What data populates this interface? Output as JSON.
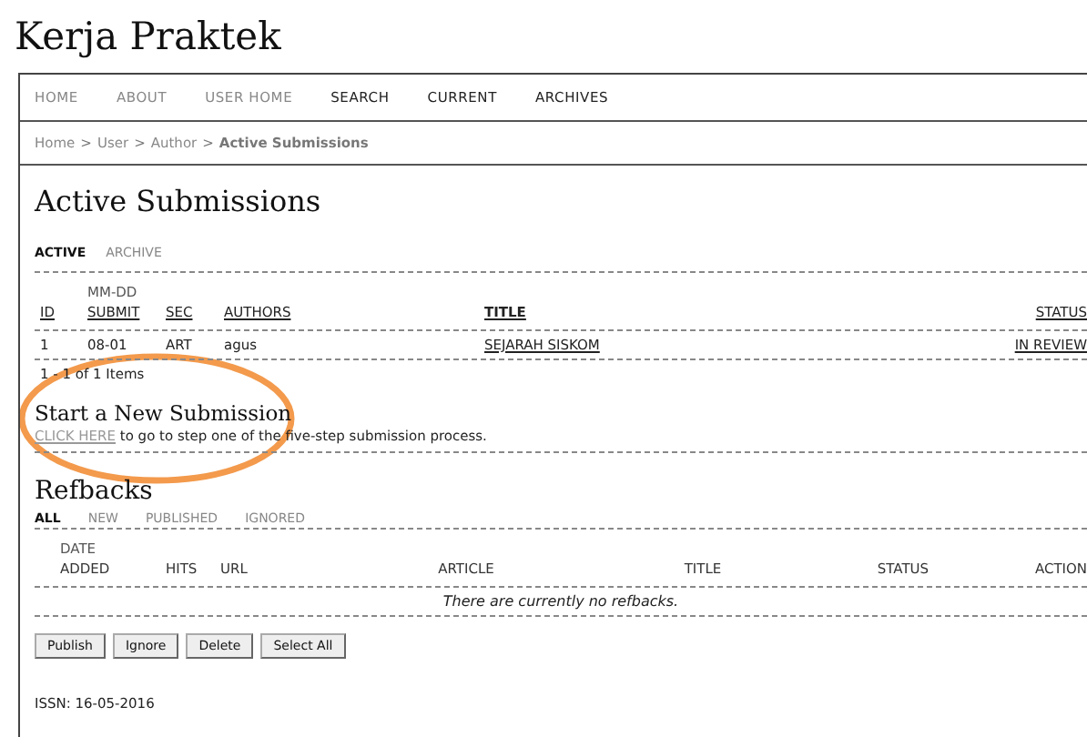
{
  "site_title": "Kerja Praktek",
  "nav": [
    {
      "label": "HOME",
      "visited": true
    },
    {
      "label": "ABOUT",
      "visited": true
    },
    {
      "label": "USER HOME",
      "visited": true
    },
    {
      "label": "SEARCH",
      "visited": false
    },
    {
      "label": "CURRENT",
      "visited": false
    },
    {
      "label": "ARCHIVES",
      "visited": false
    }
  ],
  "breadcrumb": {
    "links": [
      "Home",
      "User",
      "Author"
    ],
    "separator": ">",
    "current": "Active Submissions"
  },
  "page_title": "Active Submissions",
  "tabs": [
    {
      "label": "ACTIVE",
      "selected": true
    },
    {
      "label": "ARCHIVE",
      "selected": false
    }
  ],
  "submissions": {
    "columns": [
      {
        "label": "ID"
      },
      {
        "top": "MM-DD",
        "label": "SUBMIT"
      },
      {
        "label": "SEC"
      },
      {
        "label": "AUTHORS"
      },
      {
        "label": "TITLE"
      },
      {
        "label": "STATUS"
      }
    ],
    "rows": [
      {
        "id": "1",
        "submit": "08-01",
        "sec": "ART",
        "authors": "agus",
        "title": "SEJARAH SISKOM",
        "status": "IN REVIEW"
      }
    ],
    "pager": "1 - 1 of 1 Items"
  },
  "new_submission": {
    "heading": "Start a New Submission",
    "link": "CLICK HERE",
    "text": "to go to step one of the five-step submission process.",
    "highlighted": true
  },
  "refbacks": {
    "heading": "Refbacks",
    "tabs": [
      {
        "label": "ALL",
        "selected": true
      },
      {
        "label": "NEW",
        "selected": false
      },
      {
        "label": "PUBLISHED",
        "selected": false
      },
      {
        "label": "IGNORED",
        "selected": false
      }
    ],
    "columns": [
      {
        "top": "DATE",
        "label": "ADDED"
      },
      {
        "label": "HITS"
      },
      {
        "label": "URL"
      },
      {
        "label": "ARTICLE"
      },
      {
        "label": "TITLE"
      },
      {
        "label": "STATUS"
      },
      {
        "label": "ACTION"
      }
    ],
    "empty_message": "There are currently no refbacks.",
    "buttons": [
      "Publish",
      "Ignore",
      "Delete",
      "Select All"
    ]
  },
  "footer": "ISSN: 16-05-2016"
}
